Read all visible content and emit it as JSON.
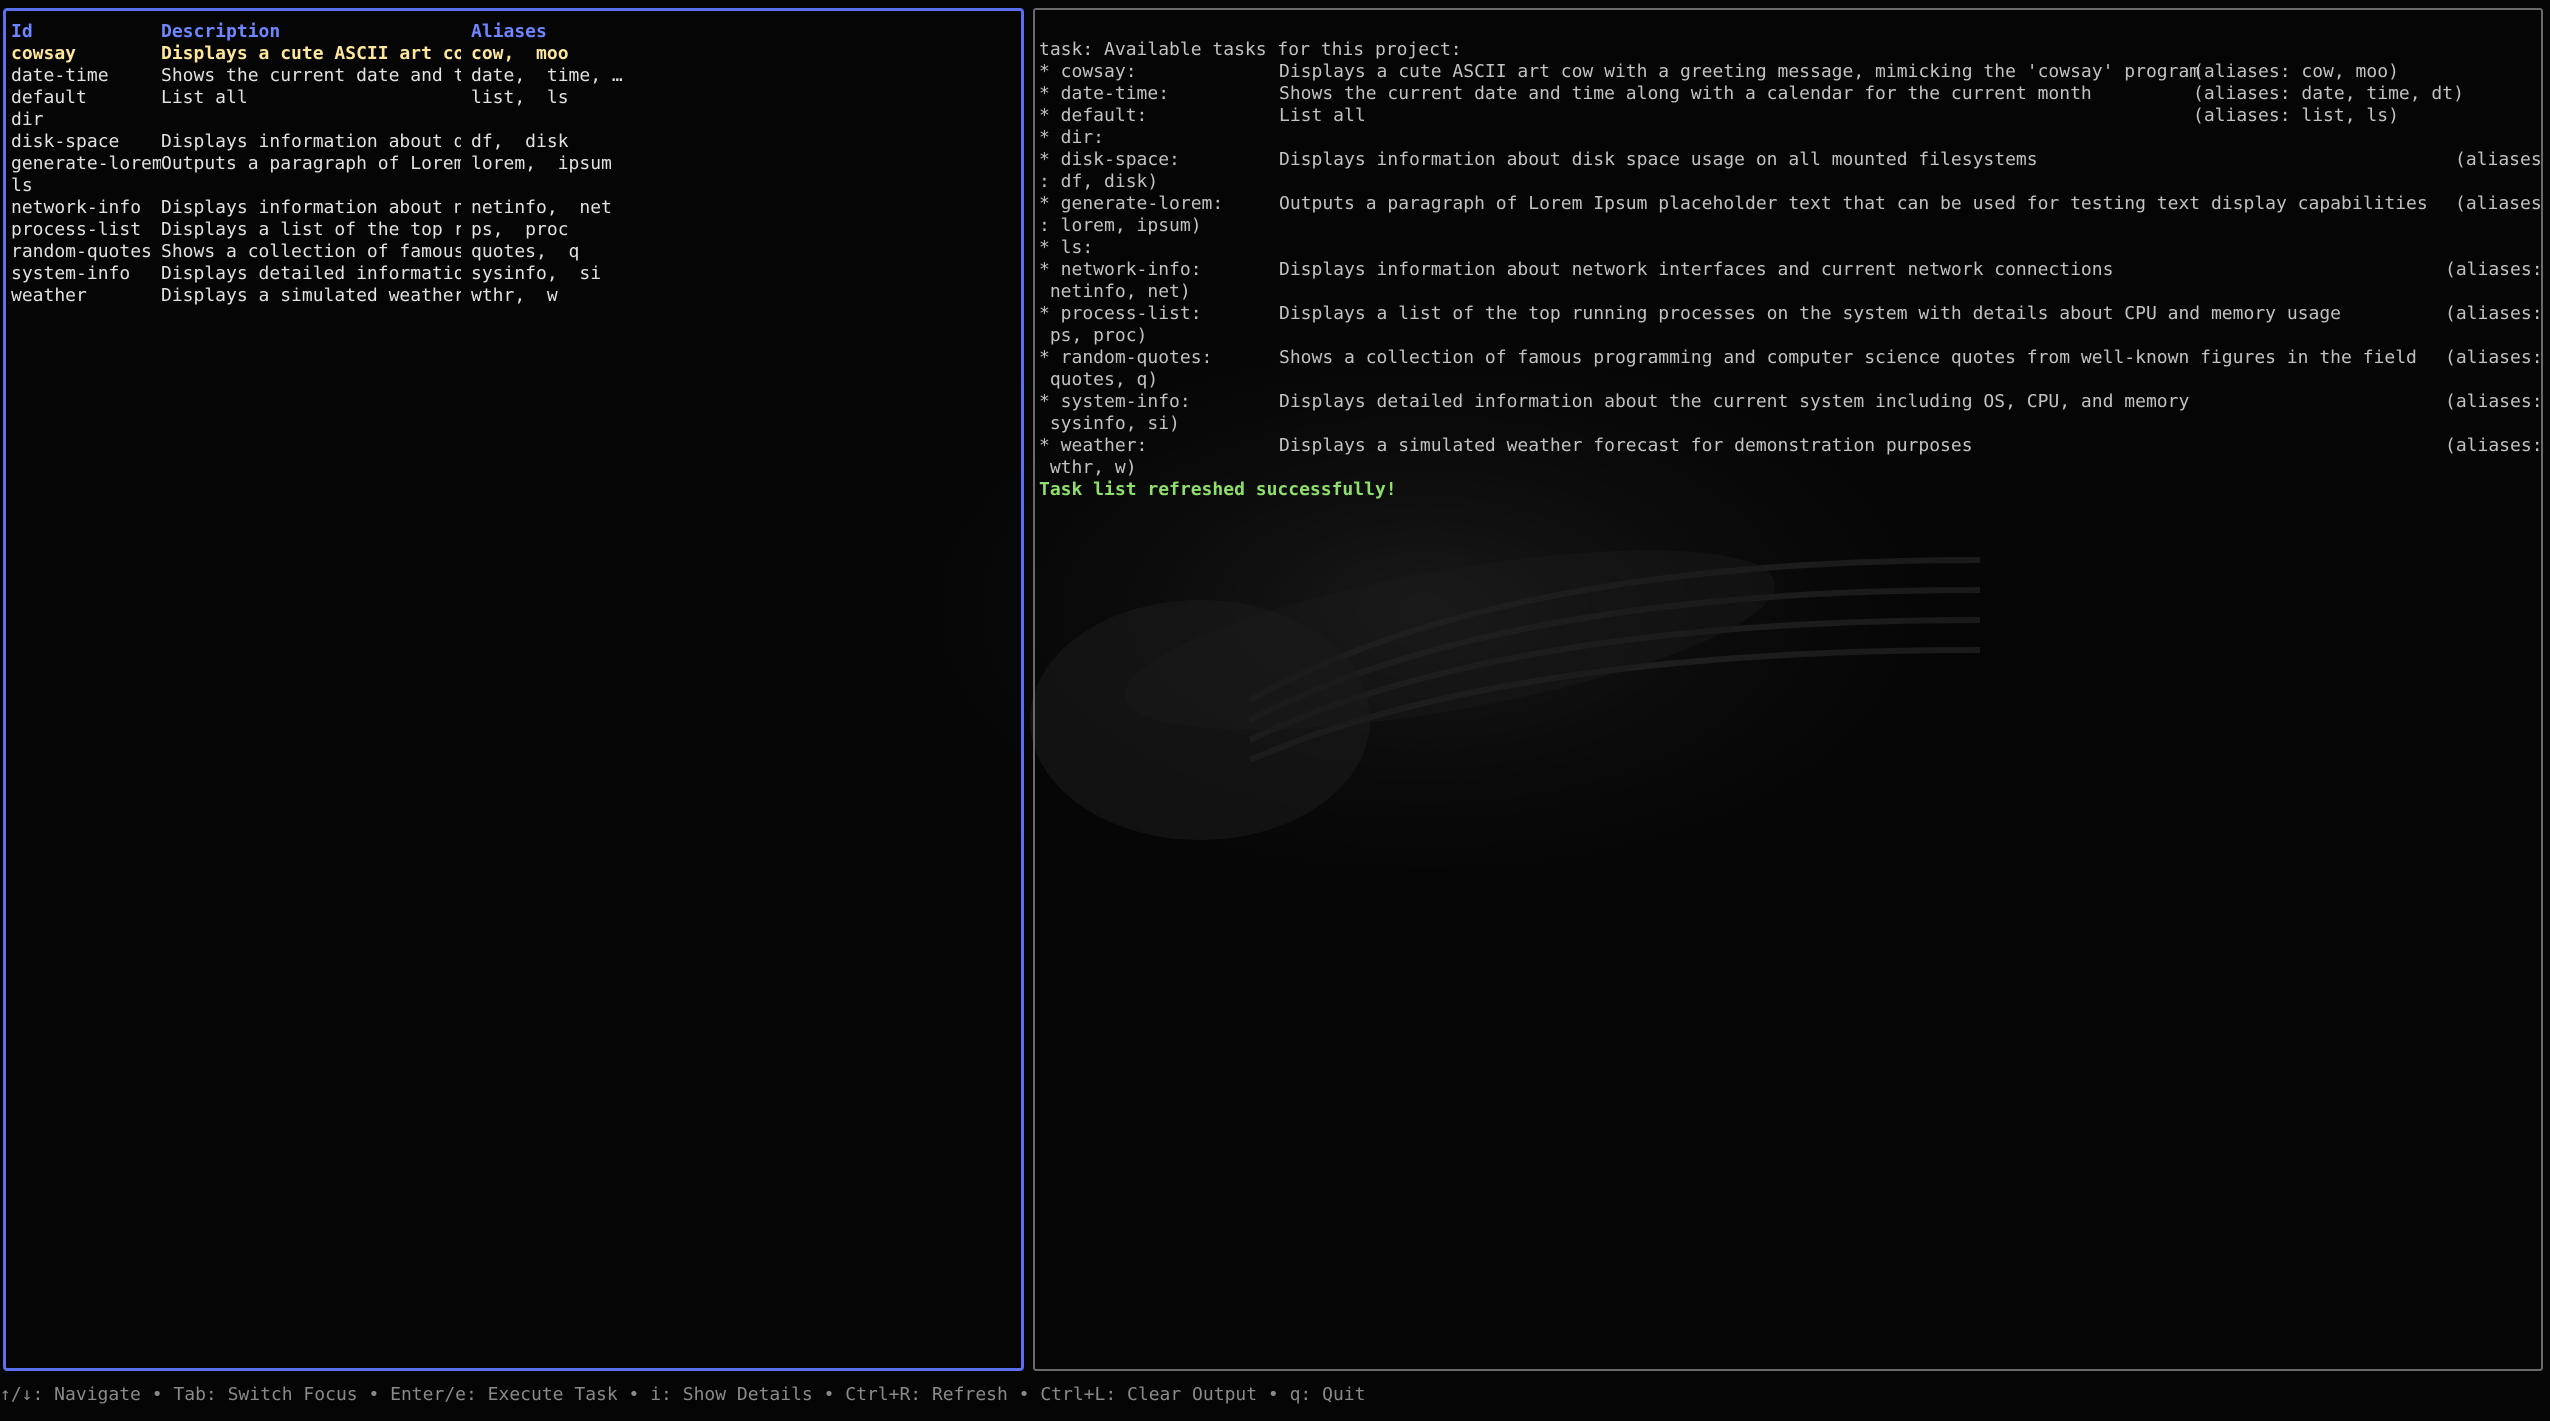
{
  "left_panel": {
    "columns": [
      "Id",
      "Description",
      "Aliases"
    ],
    "rows": [
      {
        "id": "cowsay",
        "description": "Displays a cute ASCII art cow…",
        "aliases": "cow,  moo"
      },
      {
        "id": "date-time",
        "description": "Shows the current date and ti…",
        "aliases": "date,  time, …"
      },
      {
        "id": "default",
        "description": "List all",
        "aliases": "list,  ls"
      },
      {
        "id": "dir",
        "description": "",
        "aliases": ""
      },
      {
        "id": "disk-space",
        "description": "Displays information about di…",
        "aliases": "df,  disk"
      },
      {
        "id": "generate-lorem",
        "description": "Outputs a paragraph of Lorem …",
        "aliases": "lorem,  ipsum"
      },
      {
        "id": "ls",
        "description": "",
        "aliases": ""
      },
      {
        "id": "network-info",
        "description": "Displays information about ne…",
        "aliases": "netinfo,  net"
      },
      {
        "id": "process-list",
        "description": "Displays a list of the top ru…",
        "aliases": "ps,  proc"
      },
      {
        "id": "random-quotes",
        "description": "Shows a collection of famous …",
        "aliases": "quotes,  q"
      },
      {
        "id": "system-info",
        "description": "Displays detailed information…",
        "aliases": "sysinfo,  si"
      },
      {
        "id": "weather",
        "description": "Displays a simulated weather …",
        "aliases": "wthr,  w"
      }
    ],
    "selected_index": 0
  },
  "output": {
    "header": "task: Available tasks for this project:",
    "tasks": [
      {
        "name": "* cowsay:",
        "desc": "Displays a cute ASCII art cow with a greeting message, mimicking the 'cowsay' program",
        "alias": "(aliases: cow, moo)",
        "alias_wrap": ""
      },
      {
        "name": "* date-time:",
        "desc": "Shows the current date and time along with a calendar for the current month",
        "alias": "(aliases: date, time, dt)",
        "alias_wrap": ""
      },
      {
        "name": "* default:",
        "desc": "List all",
        "alias": "(aliases: list, ls)",
        "alias_wrap": ""
      },
      {
        "name": "* dir:",
        "desc": "",
        "alias": "",
        "alias_wrap": ""
      },
      {
        "name": "* disk-space:",
        "desc": "Displays information about disk space usage on all mounted filesystems",
        "alias": "(aliases",
        "alias_wrap": ": df, disk)"
      },
      {
        "name": "* generate-lorem:",
        "desc": "Outputs a paragraph of Lorem Ipsum placeholder text that can be used for testing text display capabilities",
        "alias": "(aliases",
        "alias_wrap": ": lorem, ipsum)"
      },
      {
        "name": "* ls:",
        "desc": "",
        "alias": "",
        "alias_wrap": ""
      },
      {
        "name": "* network-info:",
        "desc": "Displays information about network interfaces and current network connections",
        "alias": "(aliases:",
        "alias_wrap": " netinfo, net)"
      },
      {
        "name": "* process-list:",
        "desc": "Displays a list of the top running processes on the system with details about CPU and memory usage",
        "alias": "(aliases:",
        "alias_wrap": " ps, proc)"
      },
      {
        "name": "* random-quotes:",
        "desc": "Shows a collection of famous programming and computer science quotes from well-known figures in the field",
        "alias": "(aliases:",
        "alias_wrap": " quotes, q)"
      },
      {
        "name": "* system-info:",
        "desc": "Displays detailed information about the current system including OS, CPU, and memory",
        "alias": "(aliases:",
        "alias_wrap": " sysinfo, si)"
      },
      {
        "name": "* weather:",
        "desc": "Displays a simulated weather forecast for demonstration purposes",
        "alias": "(aliases:",
        "alias_wrap": " wthr, w)"
      }
    ],
    "success_message": "Task list refreshed successfully!"
  },
  "statusbar": {
    "text": "↑/↓: Navigate • Tab: Switch Focus • Enter/e: Execute Task • i: Show Details • Ctrl+R: Refresh • Ctrl+L: Clear Output • q: Quit"
  },
  "colors": {
    "focus_border": "#5c6ff0",
    "header": "#6e86ff",
    "selected": "#ffe79a",
    "success": "#8ee06b"
  }
}
